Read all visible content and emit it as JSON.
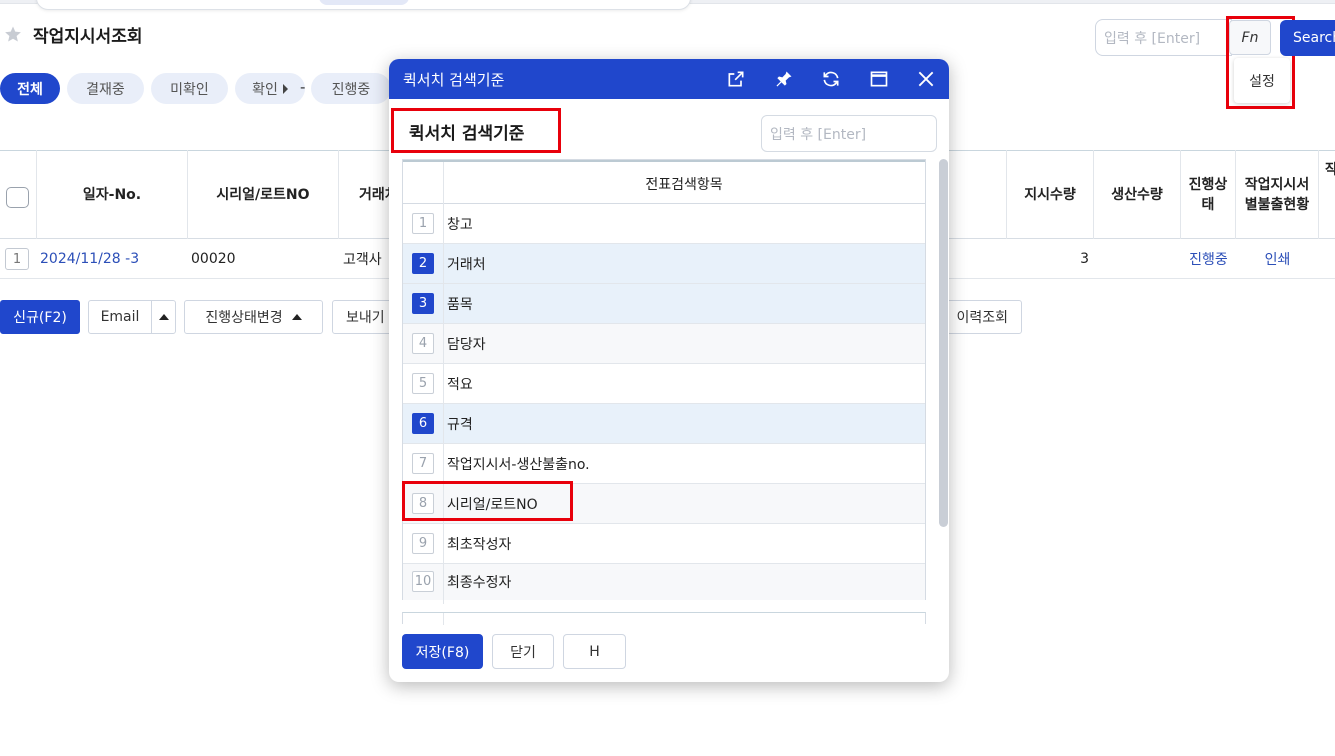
{
  "page": {
    "title": "작업지시서조회",
    "filters": [
      "전체",
      "결재중",
      "미확인",
      "확인",
      "진행중"
    ],
    "filter_dash": "-"
  },
  "search": {
    "placeholder": "입력 후 [Enter]",
    "fn_label": "Fn",
    "button": "Search",
    "fn_menu_item": "설정"
  },
  "grid": {
    "headers": [
      "일자-No.",
      "시리얼/로트NO",
      "거래처",
      "지시수량",
      "생산수량",
      "진행상태",
      "작업지시서별불출현황"
    ],
    "header_cut": "작",
    "rows": [
      {
        "num": "1",
        "date_no": "2024/11/28 -3",
        "serial": "00020",
        "client": "고객사",
        "qty": "3",
        "status": "진행중",
        "print": "인쇄"
      }
    ]
  },
  "toolbar": {
    "new": "신규(F2)",
    "email": "Email",
    "status_change": "진행상태변경",
    "send": "보내기",
    "history": "이력조회"
  },
  "dialog": {
    "title": "퀵서치 검색기준",
    "heading": "퀵서치 검색기준",
    "search_placeholder": "입력 후 [Enter]",
    "column_header": "전표검색항목",
    "items": [
      {
        "num": "1",
        "label": "창고",
        "selected": false
      },
      {
        "num": "2",
        "label": "거래처",
        "selected": true
      },
      {
        "num": "3",
        "label": "품목",
        "selected": true
      },
      {
        "num": "4",
        "label": "담당자",
        "selected": false
      },
      {
        "num": "5",
        "label": "적요",
        "selected": false
      },
      {
        "num": "6",
        "label": "규격",
        "selected": true
      },
      {
        "num": "7",
        "label": "작업지시서-생산불출no.",
        "selected": false
      },
      {
        "num": "8",
        "label": "시리얼/로트NO",
        "selected": false
      },
      {
        "num": "9",
        "label": "최초작성자",
        "selected": false
      },
      {
        "num": "10",
        "label": "최종수정자",
        "selected": false
      }
    ],
    "buttons": {
      "save": "저장(F8)",
      "close": "닫기",
      "h": "H"
    }
  },
  "colors": {
    "accent": "#2047cc",
    "highlight": "#e8000b",
    "selected_row": "#e8f1fa"
  }
}
